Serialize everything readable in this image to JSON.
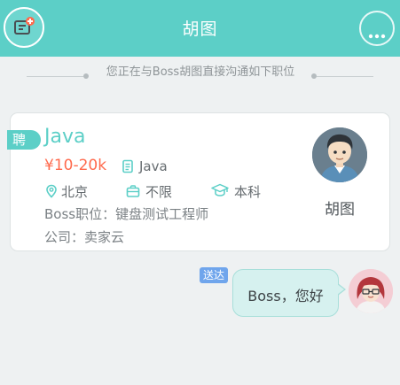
{
  "header": {
    "title": "胡图",
    "left_icon": "new-chat-icon",
    "right_icon": "more-icon",
    "color": "#5ccfc7"
  },
  "notice": {
    "text": "您正在与Boss胡图直接沟通如下职位"
  },
  "job": {
    "badge": "聘",
    "title": "Java",
    "salary": "¥10-20k",
    "category": "Java",
    "city": "北京",
    "experience": "不限",
    "education": "本科",
    "boss_role": "Boss职位：键盘测试工程师",
    "company": "公司：卖家云",
    "accent_color": "#5ccfc7",
    "salary_color": "#ff6a4d"
  },
  "recruiter": {
    "name": "胡图"
  },
  "message": {
    "status": "送达",
    "text": "Boss，您好"
  }
}
